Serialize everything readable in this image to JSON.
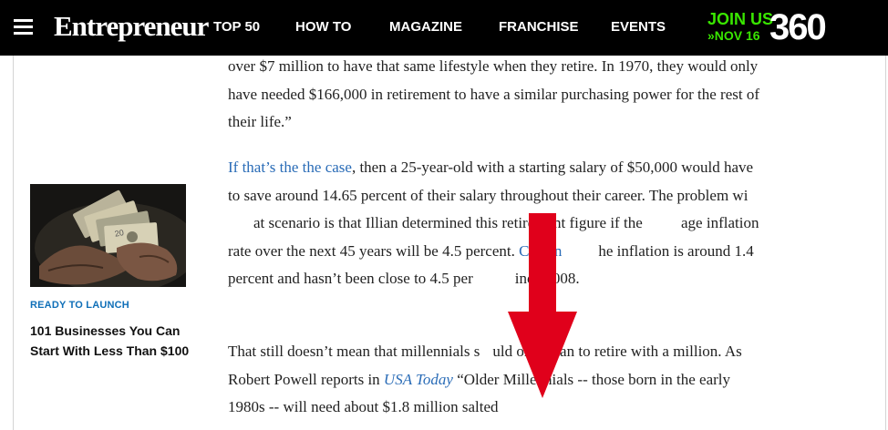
{
  "header": {
    "logo": "Entrepreneur",
    "nav": [
      "TOP 50",
      "HOW TO",
      "MAGAZINE",
      "FRANCHISE",
      "EVENTS"
    ],
    "promo": {
      "line1": "JOIN US",
      "line2": "»NOV 16",
      "number": "360"
    }
  },
  "sidebar": {
    "kicker": "READY TO LAUNCH",
    "title": "101 Businesses You Can Start With Less Than $100"
  },
  "article": {
    "p1": "over $7 million to have that same lifestyle when they retire. In 1970, they would only have needed $166,000 in retirement to have a similar purchasing power for the rest of their life.”",
    "p2_link": "If that’s the the case",
    "p2_a": ", then a 25-year-old with a starting salary of $50,000 would have to save around 14.65 percent of their salary throughout their career. The problem wi",
    "p2_b": "at scenario is that Illian determined this retirement figure if the ",
    "p2_c": "age inflation rate over the next 45 years will be 4.5 percent. ",
    "p2_link2": "Curren",
    "p2_d": "he inflation is around 1.4 percent and hasn’t been close to 4.5 per",
    "p2_e": "ince 2008.",
    "p3_a": "That still doesn’t mean that millennials s",
    "p3_b": "uld only plan to retire with a million. As Robert Powell reports in ",
    "p3_link": "USA Today",
    "p3_c": " “Older Millennials -- those born in the early 1980s -- will need about $1.8 million salted"
  },
  "colors": {
    "header_bg": "#000000",
    "promo_green": "#39e600",
    "link_blue": "#2a6cb7",
    "kicker_blue": "#0f6fb8",
    "arrow_red": "#e0001b"
  }
}
